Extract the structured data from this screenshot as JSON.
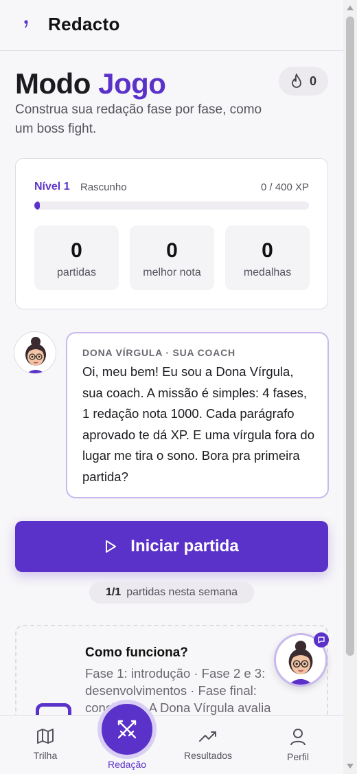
{
  "app": {
    "title": "Redacto"
  },
  "header": {
    "title_part1": "Modo",
    "title_part2": "Jogo",
    "subtitle": "Construa sua redação fase por fase, como um boss fight.",
    "streak_count": "0",
    "accent_color": "#5b32c9"
  },
  "level_card": {
    "level_label": "Nível 1",
    "level_name": "Rascunho",
    "xp_text": "0 / 400 XP",
    "xp_progress_fraction": 0.0,
    "stats": [
      {
        "value": "0",
        "label": "partidas"
      },
      {
        "value": "0",
        "label": "melhor nota"
      },
      {
        "value": "0",
        "label": "medalhas"
      }
    ]
  },
  "coach": {
    "name": "DONA VÍRGULA · SUA COACH",
    "message": "Oi, meu bem! Eu sou a Dona Vírgula, sua coach. A missão é simples: 4 fases, 1 redação nota 1000. Cada parágrafo aprovado te dá XP. E uma vírgula fora do lugar me tira o sono. Bora pra primeira partida?"
  },
  "start_button": {
    "label": "Iniciar partida"
  },
  "week_counter": {
    "count": "1/1",
    "label": "partidas nesta semana"
  },
  "how_it_works": {
    "title": "Como funciona?",
    "text": "Fase 1: introdução · Fase 2 e 3: desenvolvimentos · Fase final: conclusão. A Dona Vírgula avalia"
  },
  "bottom_nav": {
    "items": [
      {
        "label": "Trilha",
        "icon": "map-icon"
      },
      {
        "label": "Redação",
        "icon": "swords-icon"
      },
      {
        "label": "Resultados",
        "icon": "trending-up-icon"
      },
      {
        "label": "Perfil",
        "icon": "user-icon"
      }
    ]
  }
}
